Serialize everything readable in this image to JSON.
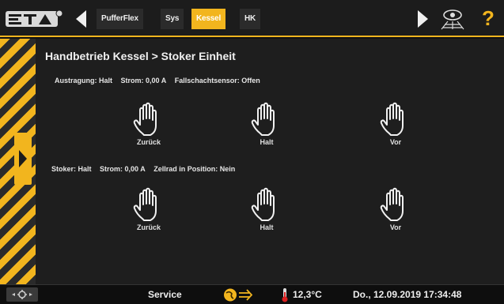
{
  "header": {
    "tabs": [
      {
        "label": "PufferFlex",
        "active": false
      },
      {
        "label": "Sys",
        "active": false
      },
      {
        "label": "Kessel",
        "active": true
      },
      {
        "label": "HK",
        "active": false
      }
    ],
    "help_label": "?"
  },
  "main": {
    "title": "Handbetrieb Kessel > Stoker Einheit",
    "section1": {
      "status": [
        "Austragung: Halt",
        "Strom: 0,00 A",
        "Fallschachtsensor: Offen"
      ],
      "buttons": [
        "Zurück",
        "Halt",
        "Vor"
      ]
    },
    "section2": {
      "status": [
        "Stoker: Halt",
        "Strom: 0,00 A",
        "Zellrad in Position: Nein"
      ],
      "buttons": [
        "Zurück",
        "Halt",
        "Vor"
      ]
    }
  },
  "footer": {
    "mode": "Service",
    "temperature": "12,3°C",
    "datetime": "Do., 12.09.2019 17:34:48"
  },
  "colors": {
    "accent": "#f2b51e",
    "background": "#1e1e1e"
  },
  "icons": [
    "eta-logo",
    "left-arrow-icon",
    "right-arrow-icon",
    "eye-network-icon",
    "hand-icon",
    "settings-icon",
    "globe-arrow-icon",
    "thermometer-icon"
  ]
}
